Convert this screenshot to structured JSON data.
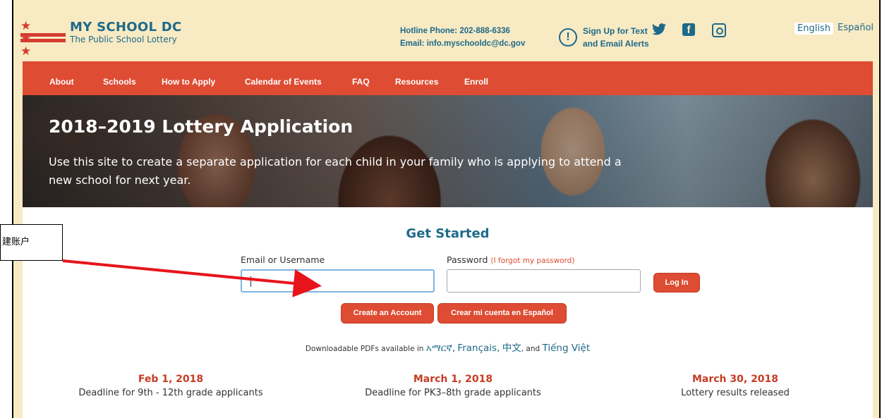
{
  "header": {
    "logo_stars": "★ ★ ★",
    "logo_title": "MY SCHOOL DC",
    "logo_subtitle": "The Public School Lottery",
    "hotline": "Hotline Phone: 202-888-6336",
    "email": "Email: info.myschooldc@dc.gov",
    "signup_line1": "Sign Up for Text",
    "signup_line2": "and Email Alerts",
    "lang_en": "English",
    "lang_es": "Español"
  },
  "nav": {
    "items": [
      "About",
      "Schools",
      "How to Apply",
      "Calendar of Events",
      "FAQ",
      "Resources",
      "Enroll"
    ]
  },
  "hero": {
    "title": "2018–2019 Lottery Application",
    "text": "Use this site to create a separate application for each child in your family who is applying to attend a new school for next year."
  },
  "login": {
    "heading": "Get Started",
    "email_label": "Email or Username",
    "password_label": "Password",
    "forgot": "(I forgot my password)",
    "email_value": "",
    "password_value": "",
    "login_button": "Log In",
    "create_button": "Create an Account",
    "crear_button": "Crear mi cuenta en Español"
  },
  "pdfs": {
    "prefix": "Downloadable PDFs available in",
    "lang1": "አማርኛ",
    "lang2": "Français",
    "lang3": "中文",
    "and": "and",
    "lang4": "Tiếng Việt"
  },
  "deadlines": [
    {
      "date": "Feb 1, 2018",
      "desc": "Deadline for 9th - 12th grade applicants"
    },
    {
      "date": "March 1, 2018",
      "desc": "Deadline for PK3–8th grade applicants"
    },
    {
      "date": "March 30, 2018",
      "desc": "Lottery results released"
    }
  ],
  "annotation": {
    "text": "建账户"
  },
  "colors": {
    "accent": "#de4c33",
    "brand": "#1e6a8a",
    "header_bg": "#f8eac3",
    "arrow": "#e8141b"
  }
}
